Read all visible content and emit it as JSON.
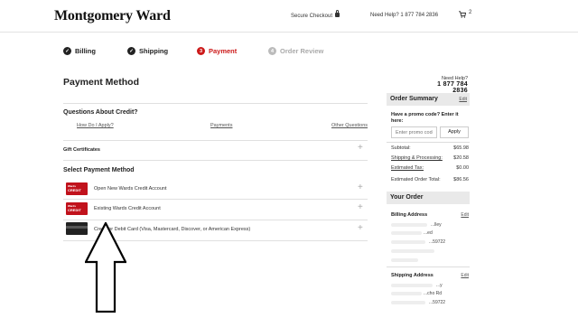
{
  "header": {
    "logo": "Montgomery Ward",
    "secure_checkout": "Secure Checkout",
    "need_help": "Need Help? 1 877 784 2836",
    "cart_count": "2"
  },
  "steps": [
    {
      "label": "Billing",
      "marker": "✓",
      "state": "done"
    },
    {
      "label": "Shipping",
      "marker": "✓",
      "state": "done"
    },
    {
      "label": "Payment",
      "marker": "3",
      "state": "current"
    },
    {
      "label": "Order Review",
      "marker": "4",
      "state": "future"
    }
  ],
  "main": {
    "title": "Payment Method",
    "need_help_label": "Need Help?",
    "need_help_phone": "1 877 784 2836",
    "credit_questions": {
      "title": "Questions About Credit?",
      "links": [
        "How Do I Apply?",
        "Payments",
        "Other Questions"
      ]
    },
    "gift_certificates": "Gift Certificates",
    "select_payment_title": "Select Payment Method",
    "payment_options": [
      {
        "label": "Open New Wards Credit Account",
        "card_top": "Wards",
        "card_bottom": "CREDIT"
      },
      {
        "label": "Existing Wards Credit Account",
        "card_top": "Wards",
        "card_bottom": "CREDIT"
      },
      {
        "label": "Credit or Debit Card (Visa, Mastercard, Discover, or American Express)"
      }
    ],
    "plus_sign": "+"
  },
  "sidebar": {
    "order_summary": {
      "title": "Order Summary",
      "edit": "Edit",
      "promo_label": "Have a promo code? Enter it here:",
      "promo_placeholder": "Enter promo code",
      "apply": "Apply",
      "rows": [
        {
          "label": "Subtotal:",
          "value": "$65.98"
        },
        {
          "label": "Shipping & Processing:",
          "value": "$20.58"
        },
        {
          "label": "Estimated Tax:",
          "value": "$0.00"
        },
        {
          "label": "Estimated Order Total:",
          "value": "$86.56"
        }
      ]
    },
    "your_order": {
      "title": "Your Order",
      "billing_title": "Billing Address",
      "billing_edit": "Edit",
      "billing_fragments": [
        "...lley",
        "...ed",
        "...59722"
      ],
      "shipping_title": "Shipping Address",
      "shipping_edit": "Edit",
      "shipping_fragments": [
        "...y",
        "...cho Rd",
        "...59722"
      ]
    }
  },
  "colors": {
    "accent": "#cc1a1a",
    "future_step": "#aaaaaa",
    "sidebar_header": "#e9e9e9"
  }
}
